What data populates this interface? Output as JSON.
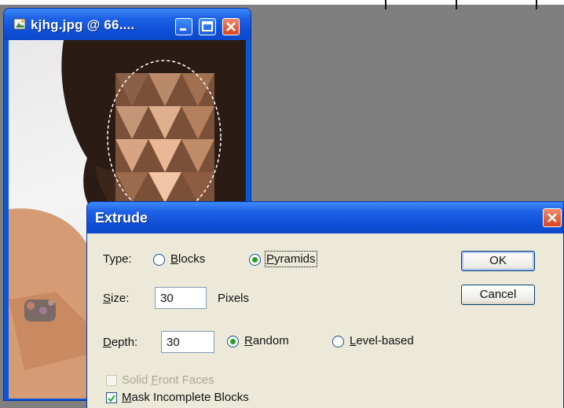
{
  "image_window": {
    "title": "kjhg.jpg @ 66....",
    "minimize_icon": "minimize-icon",
    "maximize_icon": "maximize-icon",
    "close_icon": "close-icon"
  },
  "dialog": {
    "title": "Extrude",
    "type": {
      "label": "Type:",
      "options": [
        {
          "label": "Blocks",
          "selected": false
        },
        {
          "label": "Pyramids",
          "selected": true
        }
      ]
    },
    "size": {
      "label": "Size:",
      "value": "30",
      "unit": "Pixels"
    },
    "depth": {
      "label": "Depth:",
      "value": "30",
      "options": [
        {
          "label": "Random",
          "selected": true
        },
        {
          "label": "Level-based",
          "selected": false
        }
      ]
    },
    "checkboxes": [
      {
        "label": "Solid Front Faces",
        "checked": false,
        "disabled": true
      },
      {
        "label": "Mask Incomplete Blocks",
        "checked": true,
        "disabled": false
      }
    ],
    "buttons": {
      "ok": "OK",
      "cancel": "Cancel"
    }
  },
  "colors": {
    "titlebar": "#0f4fd7",
    "dialog_bg": "#ece9d8",
    "workspace_bg": "#7f7f7f",
    "radio_dot": "#21a121"
  }
}
